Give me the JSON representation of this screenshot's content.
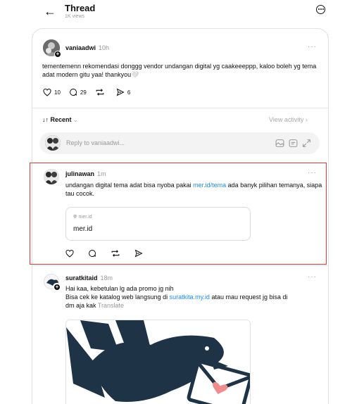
{
  "header": {
    "back_icon": "arrow-left-icon",
    "title": "Thread",
    "views": "1K views",
    "more_icon": "more-circle-icon"
  },
  "post": {
    "username": "vaniaadwi",
    "time": "10h",
    "text": "tementemenn rekomendasi donggg vendor undangan digital yg caakeeeppp, kaloo boleh yg tema adat modern gitu yaa! thankyou🤍",
    "likes": "10",
    "comments": "29",
    "shares": "6",
    "more": "···"
  },
  "sort": {
    "label": "↓↑ Recent",
    "chevron": "⌄",
    "view_activity": "View activity ›"
  },
  "reply": {
    "placeholder": "Reply to vaniaadwi..."
  },
  "replies": [
    {
      "username": "julinawan",
      "time": "1m",
      "text_before": "undangan digital tema adat bisa nyoba pakai ",
      "link": "mer.id/tema",
      "text_after": " ada banyk pilihan temanya, siapa tau cocok.",
      "link_card_domain": "mer.id",
      "link_card_title": "mer.id",
      "more": "···"
    },
    {
      "username": "suratkitaid",
      "time": "18m",
      "line1": "Hai kaa, kebetulan lg ada promo jg nih",
      "line2_before": "Bisa cek ke katalog web langsung di ",
      "link": "suratkita.my.id",
      "line2_after": " atau mau request jg bisa di",
      "line3": "dm aja kak",
      "translate": "Translate",
      "more": "···"
    }
  ],
  "colors": {
    "accent_link": "#1a8cff",
    "highlight": "#e53935",
    "dove": "#1f3346",
    "heart": "#f28b8b"
  }
}
